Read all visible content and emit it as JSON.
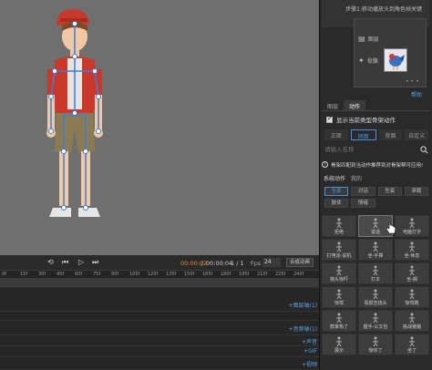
{
  "right_panel": {
    "step_title": "步骤1:移动播放头到角色帧关键",
    "layers": [
      {
        "icon": "layers-icon",
        "label": "图层"
      },
      {
        "icon": "action-icon",
        "label": "骨骼"
      }
    ],
    "dots": "•••",
    "help_link": "帮助",
    "main_tabs": [
      "图层",
      "动作"
    ],
    "show_current_checkbox": "显示当前类型骨架动作",
    "view_tabs": [
      "正面",
      "侧面",
      "背面",
      "自定义"
    ],
    "search_placeholder": "请输入名称",
    "notice": "骨架匹配到当动作推荐到对骨架帮可应用!",
    "source_tabs": [
      "系统动作",
      "我的"
    ],
    "categories": [
      "全部",
      "对话",
      "坐姿",
      "承载",
      "肢体",
      "情绪"
    ],
    "actions": [
      "拒绝",
      "说话",
      "电脑打字",
      "打电话-说机",
      "坐-手撑",
      "坐-休息",
      "抱头惊吓",
      "打伞",
      "坐-搁",
      "惊愕",
      "看报告挠头",
      "惊愕跑",
      "鼓掌热了",
      "握手-公文包",
      "挑战猪猪",
      "展示",
      "惊叹了",
      "坐了"
    ]
  },
  "playback": {
    "time_current": "00:00:02",
    "time_sep": "/",
    "time_total": "00:00:04",
    "frame_index": "1 / 1",
    "fps_label": "Fps",
    "fps_value": "24",
    "export_label": "合成动画"
  },
  "ruler": [
    "0f",
    "15f",
    "30f",
    "45f",
    "60f",
    "75f",
    "90f",
    "105f",
    "120f",
    "135f",
    "150f",
    "165f",
    "180f",
    "195f",
    "210f",
    "225f",
    "240f"
  ],
  "tracks": [
    {
      "label": "+图层轴(1)"
    },
    {
      "label": "+音频轴(1)"
    },
    {
      "label": "+声音"
    },
    {
      "label": "+GIF"
    },
    {
      "label": "+视频"
    }
  ],
  "colors": {
    "accent": "#4a90d9",
    "time": "#e4892e",
    "canvas": "#6f6f6f"
  }
}
